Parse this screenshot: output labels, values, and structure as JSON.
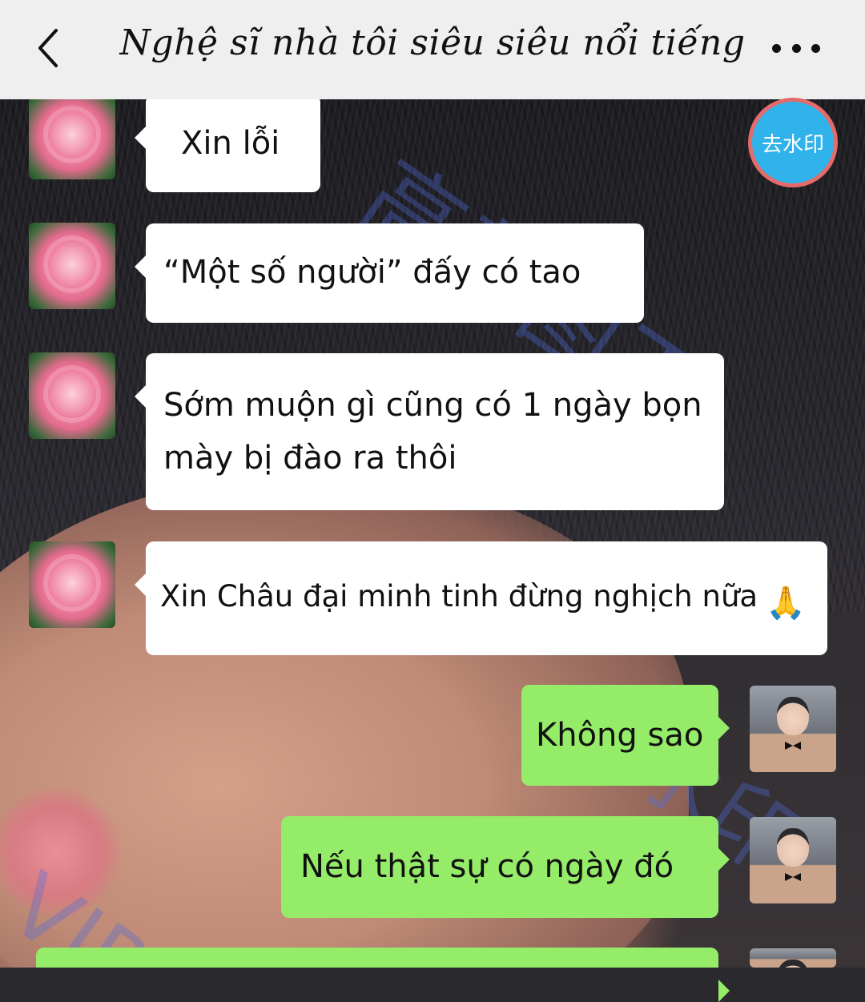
{
  "header": {
    "title": "Nghệ sĩ nhà tôi siêu siêu nổi tiếng",
    "back_icon": "chevron-left-icon",
    "more_icon": "ellipsis-icon"
  },
  "watermark_button": {
    "label": "去水印"
  },
  "watermarks": [
    "高截图王",
    "VIP",
    "去水印"
  ],
  "messages": [
    {
      "side": "left",
      "avatar": "camellia-flower",
      "text": "Xin lỗi"
    },
    {
      "side": "left",
      "avatar": "camellia-flower",
      "text": "“Một số người” đấy có tao"
    },
    {
      "side": "left",
      "avatar": "camellia-flower",
      "text_line1": "Sớm muộn gì cũng có 1 ngày bọn",
      "text_line2": "mày bị đào ra thôi"
    },
    {
      "side": "left",
      "avatar": "camellia-flower",
      "text": "Xin Châu đại minh tinh đừng nghịch nữa",
      "emoji": "🙏"
    },
    {
      "side": "right",
      "avatar": "man-in-suit",
      "text": "Không sao"
    },
    {
      "side": "right",
      "avatar": "man-in-suit",
      "text": "Nếu thật sự có ngày đó"
    },
    {
      "side": "right",
      "avatar": "man-in-suit",
      "text": ""
    }
  ],
  "colors": {
    "header_bg": "#efefef",
    "own_bubble": "#95ec69",
    "other_bubble": "#ffffff",
    "watermark_button_bg": "#2fb3ea",
    "watermark_button_border": "#e56a6a"
  }
}
